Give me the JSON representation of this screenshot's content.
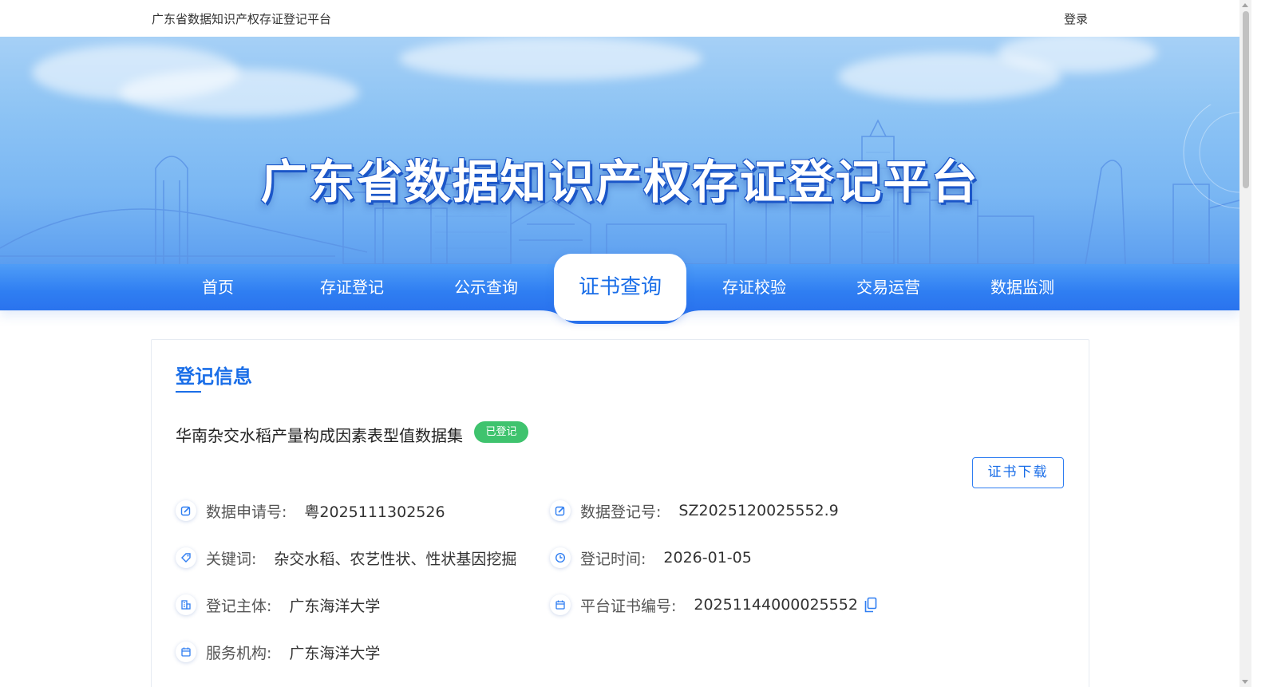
{
  "header": {
    "site_name": "广东省数据知识产权存证登记平台",
    "login_label": "登录"
  },
  "banner": {
    "title": "广东省数据知识产权存证登记平台"
  },
  "nav": {
    "items": [
      {
        "label": "首页",
        "active": false
      },
      {
        "label": "存证登记",
        "active": false
      },
      {
        "label": "公示查询",
        "active": false
      },
      {
        "label": "证书查询",
        "active": true
      },
      {
        "label": "存证校验",
        "active": false
      },
      {
        "label": "交易运营",
        "active": false
      },
      {
        "label": "数据监测",
        "active": false
      }
    ]
  },
  "record": {
    "section_title": "登记信息",
    "dataset_name": "华南杂交水稻产量构成因素表型值数据集",
    "status": "已登记",
    "download_label": "证书下载",
    "fields": {
      "application_no": {
        "label": "数据申请号:",
        "value": "粤2025111302526",
        "icon": "edit-icon"
      },
      "registration_no": {
        "label": "数据登记号:",
        "value": "SZ2025120025552.9",
        "icon": "edit-icon"
      },
      "keywords": {
        "label": "关键词:",
        "value": "杂交水稻、农艺性状、性状基因挖掘",
        "icon": "tag-icon"
      },
      "registration_time": {
        "label": "登记时间:",
        "value": "2026-01-05",
        "icon": "clock-icon"
      },
      "registrant": {
        "label": "登记主体:",
        "value": "广东海洋大学",
        "icon": "building-icon"
      },
      "certificate_no": {
        "label": "平台证书编号:",
        "value": "20251144000025552",
        "icon": "calendar-icon"
      },
      "service_org": {
        "label": "服务机构:",
        "value": "广东海洋大学",
        "icon": "calendar-icon"
      }
    }
  },
  "colors": {
    "primary": "#1a6ee8",
    "nav_bg": "#2f7ef2",
    "status_green": "#3fc36e"
  }
}
